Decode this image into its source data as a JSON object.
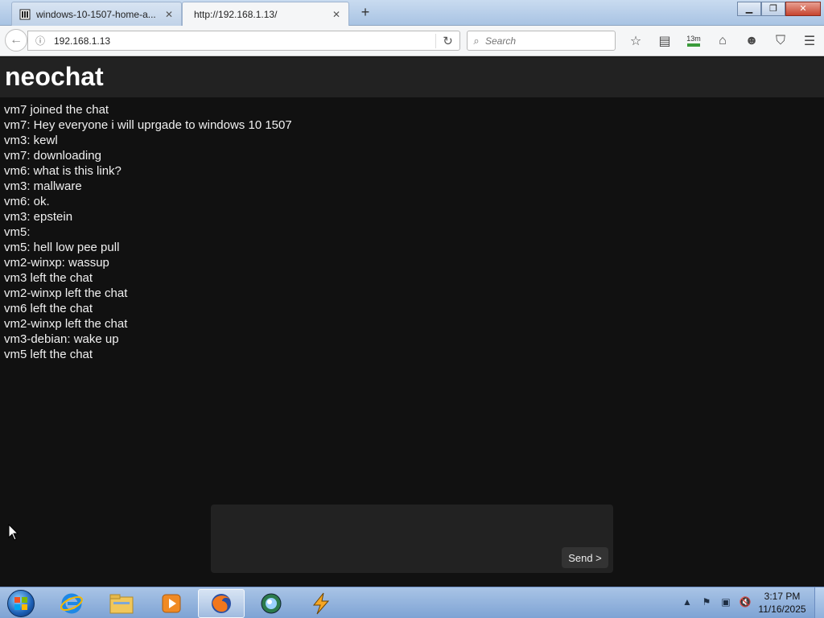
{
  "browser": {
    "tabs": [
      {
        "title": "windows-10-1507-home-a...",
        "icon": "archive-icon"
      },
      {
        "title": "http://192.168.1.13/",
        "icon": ""
      }
    ],
    "url": "192.168.1.13",
    "search_placeholder": "Search",
    "toolbar": {
      "download_badge": "13m"
    }
  },
  "page": {
    "title": "neochat",
    "messages": [
      "vm7 joined the chat",
      "vm7: Hey everyone i will uprgade to windows 10 1507",
      "vm3: kewl",
      "vm7: downloading",
      "vm6: what is this link?",
      "vm3: mallware",
      "vm6: ok.",
      "vm3: epstein",
      "vm5:",
      "vm5: hell low pee pull",
      "vm2-winxp: wassup",
      "vm3 left the chat",
      "vm2-winxp left the chat",
      "vm6 left the chat",
      "vm2-winxp left the chat",
      "vm3-debian: wake up",
      "vm5 left the chat"
    ],
    "send_label": "Send >"
  },
  "taskbar": {
    "time": "3:17 PM",
    "date": "11/16/2025"
  },
  "colors": {
    "page_bg": "#111111",
    "header_bg": "#222222",
    "text": "#f0f0f0"
  }
}
